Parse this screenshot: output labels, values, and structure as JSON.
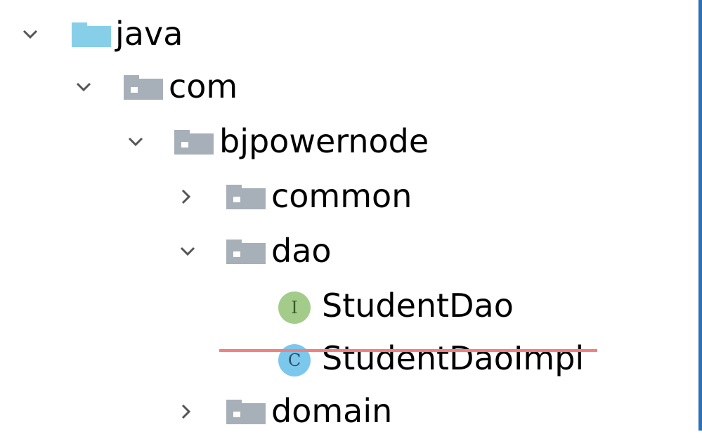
{
  "tree": {
    "nodes": [
      {
        "label": "java",
        "kind": "source-folder",
        "expanded": true,
        "icon": "source-folder-icon"
      },
      {
        "label": "com",
        "kind": "package",
        "expanded": true,
        "icon": "package-icon"
      },
      {
        "label": "bjpowernode",
        "kind": "package",
        "expanded": true,
        "icon": "package-icon"
      },
      {
        "label": "common",
        "kind": "package",
        "expanded": false,
        "icon": "package-icon"
      },
      {
        "label": "dao",
        "kind": "package",
        "expanded": true,
        "icon": "package-icon"
      },
      {
        "label": "StudentDao",
        "kind": "interface",
        "badge": "I",
        "icon": "interface-icon"
      },
      {
        "label": "StudentDaoImpl",
        "kind": "class",
        "badge": "C",
        "icon": "class-icon",
        "strikethrough": true
      },
      {
        "label": "domain",
        "kind": "package",
        "expanded": false,
        "icon": "package-icon"
      }
    ]
  },
  "colors": {
    "source_folder": "#87cfe9",
    "package_folder": "#a7b0b9",
    "interface_badge": "#a3cc8a",
    "class_badge": "#7cc7ec",
    "strikethrough": "#f08080",
    "window_border": "#2f6fb3"
  }
}
